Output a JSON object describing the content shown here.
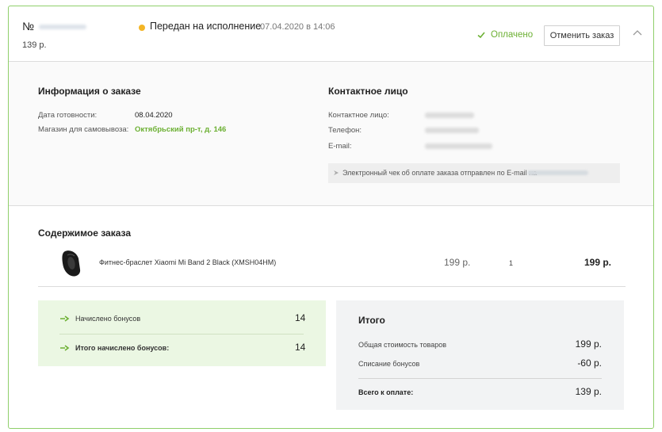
{
  "order": {
    "number_prefix": "№",
    "sum": "139 р.",
    "status": "Передан на исполнение",
    "status_date": "07.04.2020 в 14:06",
    "paid_label": "Оплачено",
    "cancel_label": "Отменить заказ"
  },
  "info": {
    "title": "Информация о заказе",
    "ready_label": "Дата готовности:",
    "ready_value": "08.04.2020",
    "store_label": "Магазин для самовывоза:",
    "store_value": "Октябрьский пр-т, д. 146"
  },
  "contact": {
    "title": "Контактное лицо",
    "person_label": "Контактное лицо:",
    "phone_label": "Телефон:",
    "email_label": "E-mail:",
    "receipt_text": "Электронный чек об оплате заказа отправлен по E-mail на"
  },
  "contents": {
    "title": "Содержимое заказа",
    "items": [
      {
        "name": "Фитнес-браслет Xiaomi Mi Band 2 Black (XMSH04HM)",
        "price": "199 р.",
        "qty": "1",
        "total": "199 р."
      }
    ]
  },
  "bonus": {
    "accrued_label": "Начислено бонусов",
    "accrued_value": "14",
    "total_label": "Итого начислено бонусов:",
    "total_value": "14"
  },
  "totals": {
    "title": "Итого",
    "goods_label": "Общая стоимость товаров",
    "goods_value": "199 р.",
    "bonus_label": "Списание бонусов",
    "bonus_value": "-60 р.",
    "pay_label": "Всего к оплате:",
    "pay_value": "139 р."
  },
  "colors": {
    "accent_green": "#6cb033",
    "status_yellow": "#f3b526",
    "border_green": "#8fcf6a"
  }
}
